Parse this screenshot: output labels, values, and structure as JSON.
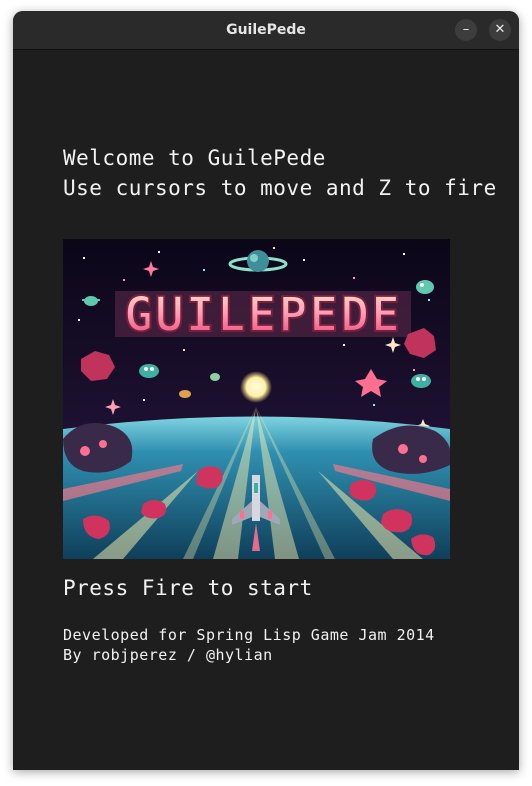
{
  "window": {
    "title": "GuilePede",
    "minimize_label": "–",
    "close_label": "✕"
  },
  "screen": {
    "welcome_line1": "Welcome to GuilePede",
    "welcome_line2": "Use cursors to move and Z to fire",
    "press_fire": "Press Fire to start",
    "credit_line1": "Developed for Spring Lisp Game Jam 2014",
    "credit_line2": "By robjperez / @hylian"
  },
  "title_art": {
    "logo_text": "GUILEPEDE",
    "colors": {
      "sky_top": "#0b0618",
      "sky_bottom": "#2a1640",
      "floor": "#1f6f8b",
      "logo_pink": "#ff7aa0",
      "logo_cream": "#ffe6c8",
      "beam": "#fff4b0"
    }
  }
}
